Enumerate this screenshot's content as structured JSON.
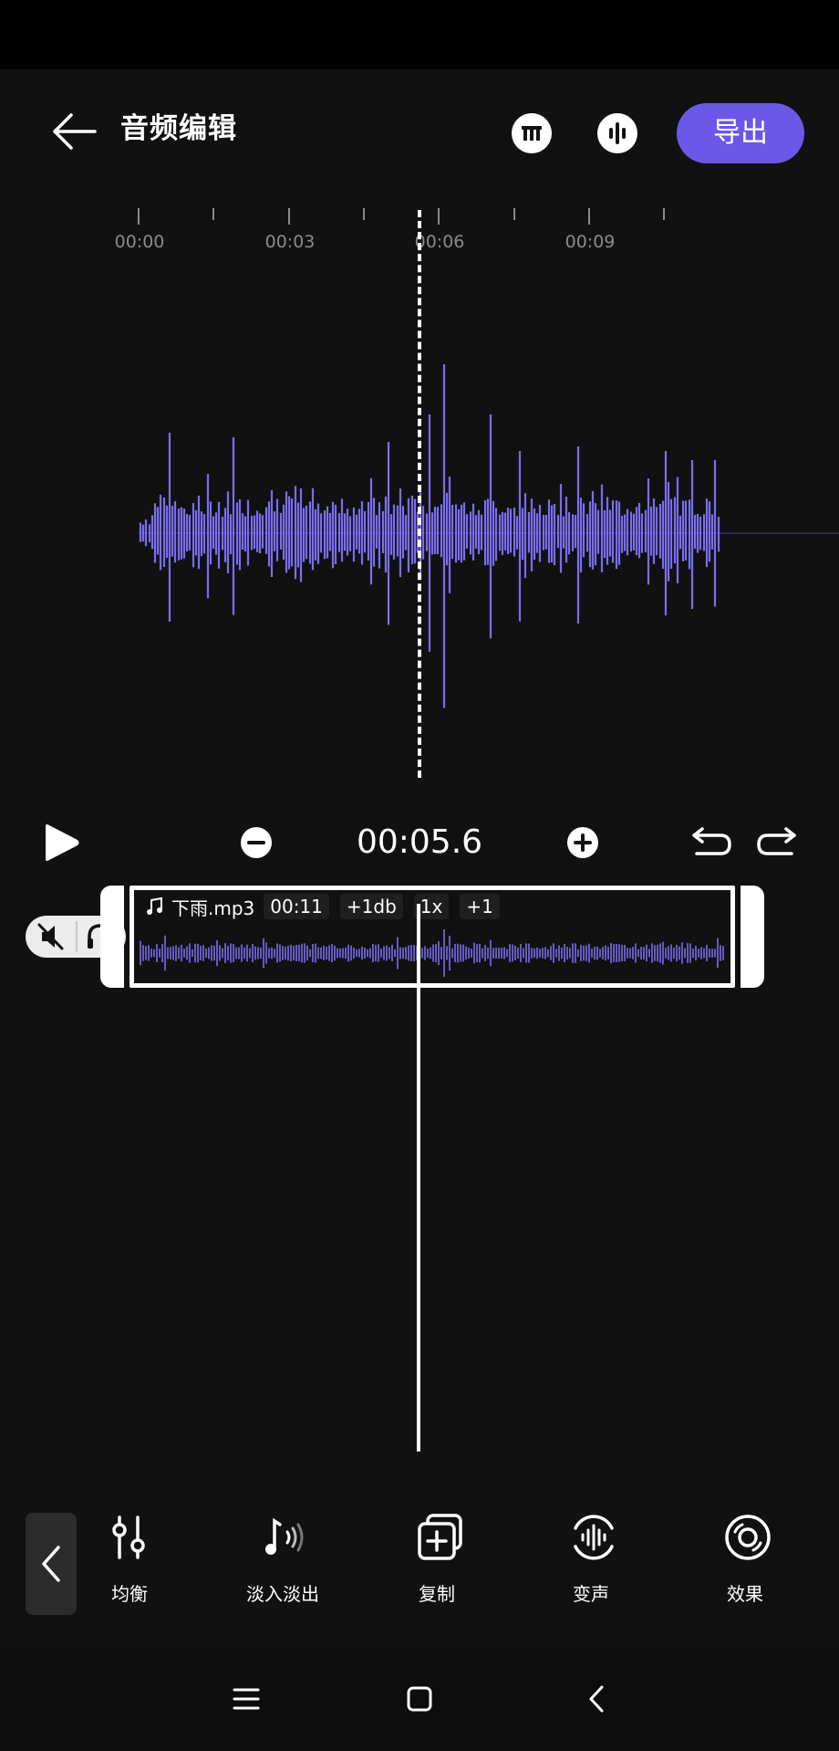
{
  "header": {
    "title": "音频编辑",
    "export_label": "导出"
  },
  "ruler": {
    "labels": [
      "00:00",
      "00:03",
      "00:06",
      "00:09"
    ]
  },
  "controls": {
    "current_time": "00:05.6"
  },
  "clip": {
    "filename": "下雨.mp3",
    "duration": "00:11",
    "volume": "+1db",
    "speed": "1x",
    "pitch": "+1"
  },
  "toolbar": {
    "items": [
      {
        "label": "均衡",
        "icon": "equalizer-icon"
      },
      {
        "label": "淡入淡出",
        "icon": "fade-icon"
      },
      {
        "label": "复制",
        "icon": "copy-icon"
      },
      {
        "label": "变声",
        "icon": "voice-change-icon"
      },
      {
        "label": "效果",
        "icon": "effect-icon"
      }
    ]
  },
  "colors": {
    "accent": "#6b58e8",
    "waveform": "#7b6df0",
    "background": "#111111"
  }
}
